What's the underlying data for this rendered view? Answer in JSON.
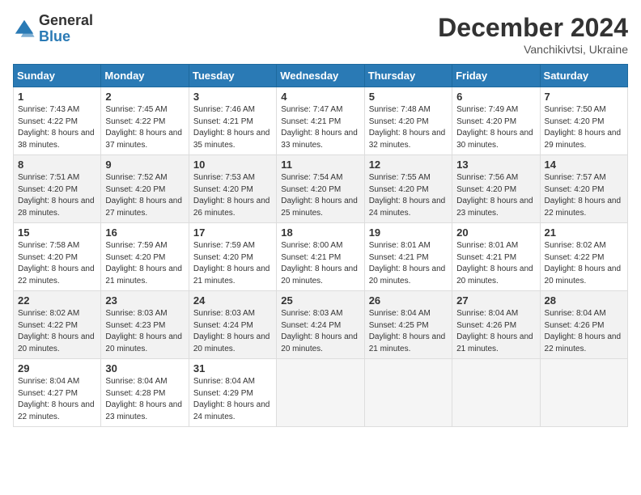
{
  "header": {
    "logo_general": "General",
    "logo_blue": "Blue",
    "month": "December 2024",
    "location": "Vanchikivtsi, Ukraine"
  },
  "days_of_week": [
    "Sunday",
    "Monday",
    "Tuesday",
    "Wednesday",
    "Thursday",
    "Friday",
    "Saturday"
  ],
  "weeks": [
    [
      {
        "day": "1",
        "sunrise": "7:43 AM",
        "sunset": "4:22 PM",
        "daylight": "8 hours and 38 minutes"
      },
      {
        "day": "2",
        "sunrise": "7:45 AM",
        "sunset": "4:22 PM",
        "daylight": "8 hours and 37 minutes"
      },
      {
        "day": "3",
        "sunrise": "7:46 AM",
        "sunset": "4:21 PM",
        "daylight": "8 hours and 35 minutes"
      },
      {
        "day": "4",
        "sunrise": "7:47 AM",
        "sunset": "4:21 PM",
        "daylight": "8 hours and 33 minutes"
      },
      {
        "day": "5",
        "sunrise": "7:48 AM",
        "sunset": "4:20 PM",
        "daylight": "8 hours and 32 minutes"
      },
      {
        "day": "6",
        "sunrise": "7:49 AM",
        "sunset": "4:20 PM",
        "daylight": "8 hours and 30 minutes"
      },
      {
        "day": "7",
        "sunrise": "7:50 AM",
        "sunset": "4:20 PM",
        "daylight": "8 hours and 29 minutes"
      }
    ],
    [
      {
        "day": "8",
        "sunrise": "7:51 AM",
        "sunset": "4:20 PM",
        "daylight": "8 hours and 28 minutes"
      },
      {
        "day": "9",
        "sunrise": "7:52 AM",
        "sunset": "4:20 PM",
        "daylight": "8 hours and 27 minutes"
      },
      {
        "day": "10",
        "sunrise": "7:53 AM",
        "sunset": "4:20 PM",
        "daylight": "8 hours and 26 minutes"
      },
      {
        "day": "11",
        "sunrise": "7:54 AM",
        "sunset": "4:20 PM",
        "daylight": "8 hours and 25 minutes"
      },
      {
        "day": "12",
        "sunrise": "7:55 AM",
        "sunset": "4:20 PM",
        "daylight": "8 hours and 24 minutes"
      },
      {
        "day": "13",
        "sunrise": "7:56 AM",
        "sunset": "4:20 PM",
        "daylight": "8 hours and 23 minutes"
      },
      {
        "day": "14",
        "sunrise": "7:57 AM",
        "sunset": "4:20 PM",
        "daylight": "8 hours and 22 minutes"
      }
    ],
    [
      {
        "day": "15",
        "sunrise": "7:58 AM",
        "sunset": "4:20 PM",
        "daylight": "8 hours and 22 minutes"
      },
      {
        "day": "16",
        "sunrise": "7:59 AM",
        "sunset": "4:20 PM",
        "daylight": "8 hours and 21 minutes"
      },
      {
        "day": "17",
        "sunrise": "7:59 AM",
        "sunset": "4:20 PM",
        "daylight": "8 hours and 21 minutes"
      },
      {
        "day": "18",
        "sunrise": "8:00 AM",
        "sunset": "4:21 PM",
        "daylight": "8 hours and 20 minutes"
      },
      {
        "day": "19",
        "sunrise": "8:01 AM",
        "sunset": "4:21 PM",
        "daylight": "8 hours and 20 minutes"
      },
      {
        "day": "20",
        "sunrise": "8:01 AM",
        "sunset": "4:21 PM",
        "daylight": "8 hours and 20 minutes"
      },
      {
        "day": "21",
        "sunrise": "8:02 AM",
        "sunset": "4:22 PM",
        "daylight": "8 hours and 20 minutes"
      }
    ],
    [
      {
        "day": "22",
        "sunrise": "8:02 AM",
        "sunset": "4:22 PM",
        "daylight": "8 hours and 20 minutes"
      },
      {
        "day": "23",
        "sunrise": "8:03 AM",
        "sunset": "4:23 PM",
        "daylight": "8 hours and 20 minutes"
      },
      {
        "day": "24",
        "sunrise": "8:03 AM",
        "sunset": "4:24 PM",
        "daylight": "8 hours and 20 minutes"
      },
      {
        "day": "25",
        "sunrise": "8:03 AM",
        "sunset": "4:24 PM",
        "daylight": "8 hours and 20 minutes"
      },
      {
        "day": "26",
        "sunrise": "8:04 AM",
        "sunset": "4:25 PM",
        "daylight": "8 hours and 21 minutes"
      },
      {
        "day": "27",
        "sunrise": "8:04 AM",
        "sunset": "4:26 PM",
        "daylight": "8 hours and 21 minutes"
      },
      {
        "day": "28",
        "sunrise": "8:04 AM",
        "sunset": "4:26 PM",
        "daylight": "8 hours and 22 minutes"
      }
    ],
    [
      {
        "day": "29",
        "sunrise": "8:04 AM",
        "sunset": "4:27 PM",
        "daylight": "8 hours and 22 minutes"
      },
      {
        "day": "30",
        "sunrise": "8:04 AM",
        "sunset": "4:28 PM",
        "daylight": "8 hours and 23 minutes"
      },
      {
        "day": "31",
        "sunrise": "8:04 AM",
        "sunset": "4:29 PM",
        "daylight": "8 hours and 24 minutes"
      },
      null,
      null,
      null,
      null
    ]
  ]
}
